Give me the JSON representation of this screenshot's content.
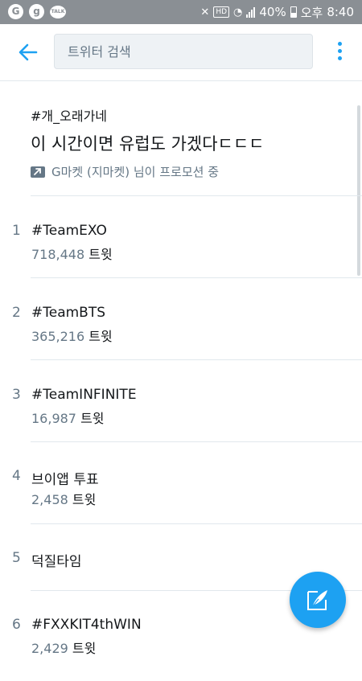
{
  "status_bar": {
    "left_icons": [
      {
        "name": "carrier-g-icon",
        "glyph": "G"
      },
      {
        "name": "g-app-icon",
        "glyph": "g"
      },
      {
        "name": "kakaotalk-icon",
        "glyph": "TALK"
      }
    ],
    "battery": "40%",
    "ampm": "오후",
    "time": "8:40",
    "hd_label": "HD"
  },
  "header": {
    "search_placeholder": "트위터 검색"
  },
  "promoted": {
    "hashtag": "#개_오래가네",
    "description": "이 시간이면 유럽도 가겠다ㄷㄷㄷ",
    "promoter_line": "G마켓 (지마켓) 님이 프로모션 중"
  },
  "trends": [
    {
      "rank": "1",
      "name": "#TeamEXO",
      "count": "718,448",
      "unit": "트윗"
    },
    {
      "rank": "2",
      "name": "#TeamBTS",
      "count": "365,216",
      "unit": "트윗"
    },
    {
      "rank": "3",
      "name": "#TeamINFINITE",
      "count": "16,987",
      "unit": "트윗"
    },
    {
      "rank": "4",
      "name": "브이앱 투표",
      "count": "2,458",
      "unit": "트윗"
    },
    {
      "rank": "5",
      "name": "덕질타임",
      "count": "",
      "unit": ""
    },
    {
      "rank": "6",
      "name": "#FXXKIT4thWIN",
      "count": "2,429",
      "unit": "트윗"
    }
  ],
  "colors": {
    "accent": "#1da1f2",
    "status_bar": "#8a8f94",
    "secondary_text": "#657786",
    "divider": "#e1e8ed"
  }
}
